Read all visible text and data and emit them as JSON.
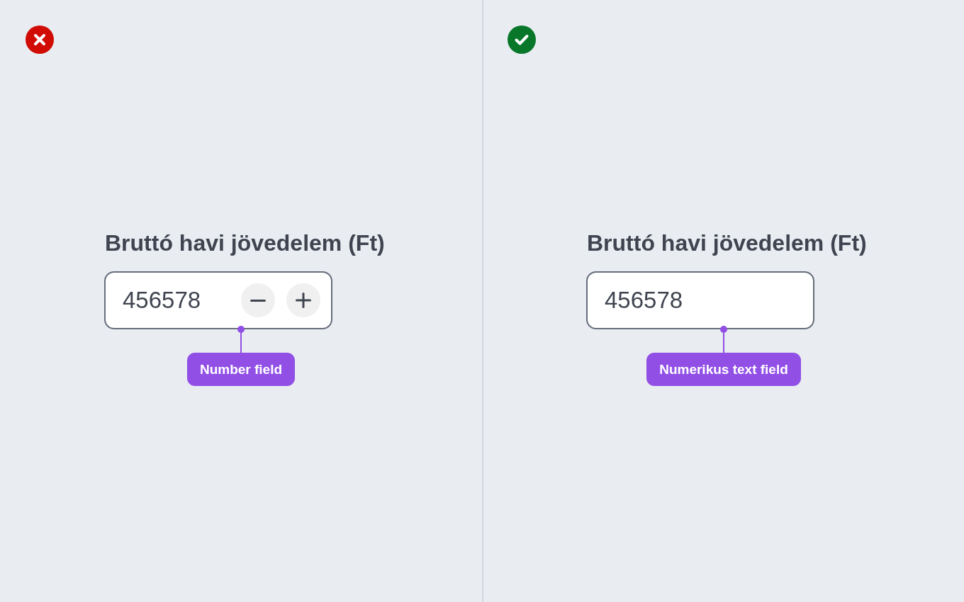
{
  "panels": [
    {
      "correct": false,
      "field": {
        "label": "Bruttó havi jövedelem (Ft)",
        "value": "456578",
        "kind": "stepper"
      },
      "annotation": "Number field"
    },
    {
      "correct": true,
      "field": {
        "label": "Bruttó havi jövedelem (Ft)",
        "value": "456578",
        "kind": "text"
      },
      "annotation": "Numerikus text field"
    }
  ]
}
